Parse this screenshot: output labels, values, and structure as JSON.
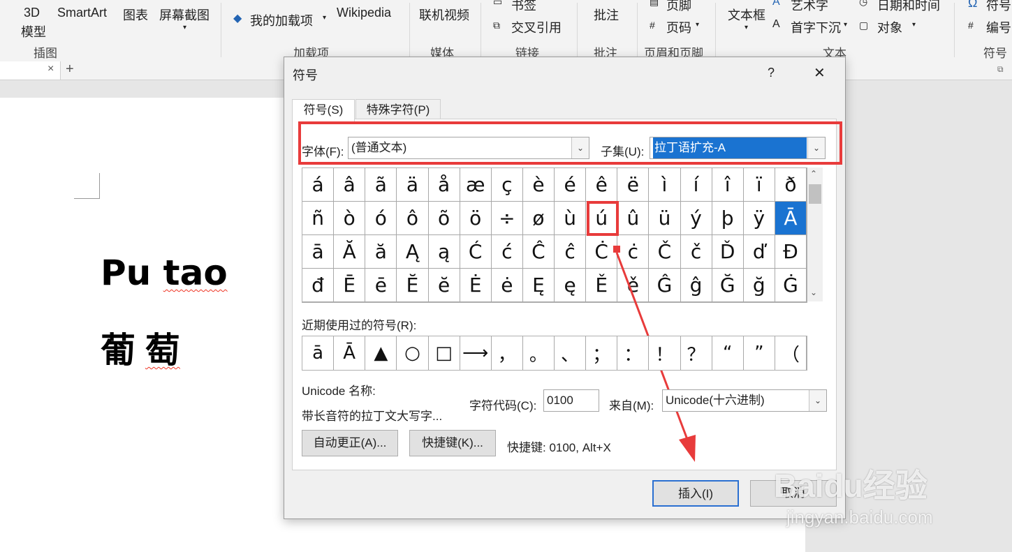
{
  "ribbon": {
    "items": {
      "model3d": "3D",
      "model3d_sub": "模型",
      "smartart": "SmartArt",
      "chart": "图表",
      "screenshot": "屏幕截图",
      "my_addins": "我的加载项",
      "wikipedia": "Wikipedia",
      "online_video": "联机视频",
      "bookmark": "书签",
      "cross_ref": "交叉引用",
      "comment": "批注",
      "footer": "页脚",
      "page_number": "页码",
      "textbox": "文本框",
      "wordart": "艺术字",
      "dropcap": "首字下沉",
      "datetime": "日期和时间",
      "object": "对象",
      "symbol": "符号",
      "numbering": "编号"
    },
    "groups": {
      "illustrations": "插图",
      "addins": "加载项",
      "media": "媒体",
      "links": "链接",
      "comments": "批注",
      "header_footer": "页眉和页脚",
      "text": "文本",
      "symbols": "符号"
    }
  },
  "document": {
    "line1_a": "Pu",
    "line1_b": "tao",
    "line2_a": "葡",
    "line2_b": "萄"
  },
  "dialog": {
    "title": "符号",
    "help": "?",
    "close": "✕",
    "tabs": [
      "符号(S)",
      "特殊字符(P)"
    ],
    "font_label": "字体(F):",
    "font_value": "(普通文本)",
    "subset_label": "子集(U):",
    "subset_value": "拉丁语扩充-A",
    "symbols": [
      "á",
      "â",
      "ã",
      "ä",
      "å",
      "æ",
      "ç",
      "è",
      "é",
      "ê",
      "ë",
      "ì",
      "í",
      "î",
      "ï",
      "ð",
      "ñ",
      "ò",
      "ó",
      "ô",
      "õ",
      "ö",
      "÷",
      "ø",
      "ù",
      "ú",
      "û",
      "ü",
      "ý",
      "þ",
      "ÿ",
      "Ā",
      "ā",
      "Ă",
      "ă",
      "Ą",
      "ą",
      "Ć",
      "ć",
      "Ĉ",
      "ĉ",
      "Ċ",
      "ċ",
      "Č",
      "č",
      "Ď",
      "ď",
      "Đ",
      "đ",
      "Ē",
      "ē",
      "Ĕ",
      "ĕ",
      "Ė",
      "ė",
      "Ę",
      "ę",
      "Ě",
      "ě",
      "Ĝ",
      "ĝ",
      "Ğ",
      "ğ",
      "Ġ"
    ],
    "selected_symbol": "Ā",
    "highlighted_symbol": "ú",
    "recent_label": "近期使用过的符号(R):",
    "recent_symbols": [
      "ā",
      "Ā",
      "▲",
      "○",
      "□",
      "⟶",
      "，",
      "。",
      "、",
      "；",
      "：",
      "！",
      "？",
      "“",
      "”",
      "（"
    ],
    "unicode_name_label": "Unicode 名称:",
    "unicode_name": "带长音符的拉丁文大写字...",
    "char_code_label": "字符代码(C):",
    "char_code": "0100",
    "from_label": "来自(M):",
    "from_value": "Unicode(十六进制)",
    "autocorrect_btn": "自动更正(A)...",
    "shortcut_btn": "快捷键(K)...",
    "shortcut_text": "快捷键: 0100, Alt+X",
    "insert_btn": "插入(I)",
    "cancel_btn": "取消"
  },
  "watermark": {
    "brand": "Baidu经验",
    "url": "jingyan.baidu.com"
  },
  "colors": {
    "annotation_red": "#e83b3b",
    "selection_blue": "#1a73d1"
  }
}
